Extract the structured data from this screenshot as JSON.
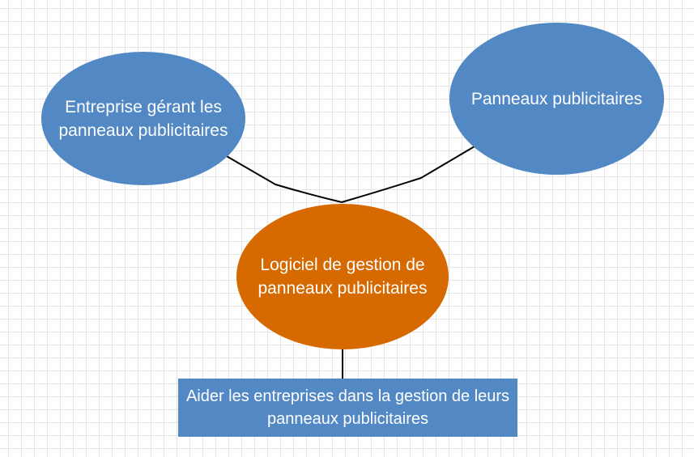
{
  "diagram": {
    "nodes": {
      "company": {
        "label": "Entreprise gérant les panneaux publicitaires",
        "shape": "ellipse",
        "color": "#5288c4"
      },
      "billboards": {
        "label": "Panneaux publicitaires",
        "shape": "ellipse",
        "color": "#5288c4"
      },
      "software": {
        "label": "Logiciel de gestion de panneaux publicitaires",
        "shape": "ellipse",
        "color": "#d66900"
      },
      "goal": {
        "label": "Aider les entreprises dans la gestion de leurs panneaux publicitaires",
        "shape": "rectangle",
        "color": "#5288c4"
      }
    },
    "edges": [
      {
        "from": "company",
        "to": "software"
      },
      {
        "from": "billboards",
        "to": "software"
      },
      {
        "from": "software",
        "to": "goal"
      }
    ]
  }
}
